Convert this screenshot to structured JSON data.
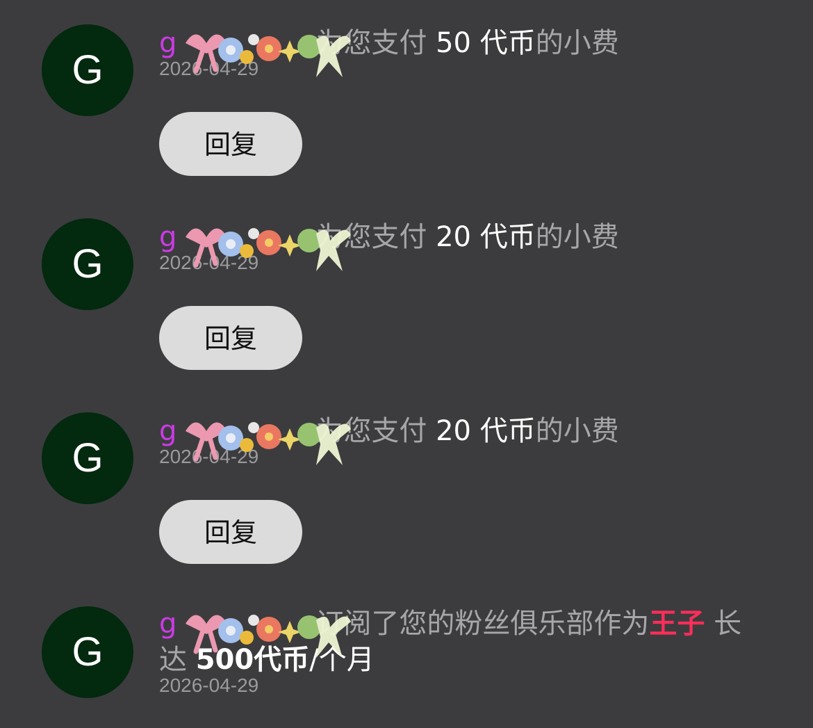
{
  "notifications": [
    {
      "avatar_letter": "G",
      "username": "g",
      "action": "为您支付",
      "amount": "50 代币",
      "suffix": "的小费",
      "date": "2026-04-29",
      "reply_label": "回复"
    },
    {
      "avatar_letter": "G",
      "username": "g",
      "action": "为您支付",
      "amount": "20 代币",
      "suffix": "的小费",
      "date": "2026-04-29",
      "reply_label": "回复"
    },
    {
      "avatar_letter": "G",
      "username": "g",
      "action": "为您支付",
      "amount": "20 代币",
      "suffix": "的小费",
      "date": "2026-04-29",
      "reply_label": "回复"
    },
    {
      "avatar_letter": "G",
      "username": "g",
      "action": "订阅了您的粉丝俱乐部作为",
      "tier": "王子",
      "duration_prefix": "长达",
      "price": "500代币",
      "period": "/个月",
      "date": "2026-04-29"
    }
  ],
  "colors": {
    "background": "#3c3c3e",
    "avatar_bg": "#03290f",
    "username": "#cc3ae6",
    "tier": "#ff2d59",
    "reply_bg": "#dcdcdc"
  },
  "icons": {
    "sticker_overlay": "decorative-flower-sticker-icon"
  }
}
